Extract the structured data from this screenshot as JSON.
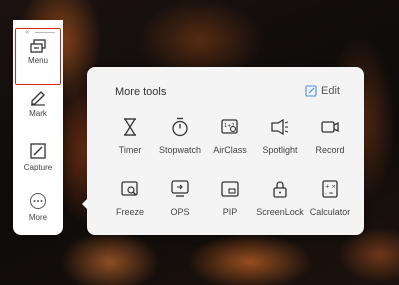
{
  "sidebar": {
    "collapse_glyph": "«",
    "menu_label": "Menu",
    "mark_label": "Mark",
    "capture_label": "Capture",
    "more_label": "More"
  },
  "panel": {
    "title": "More tools",
    "edit_label": "Edit",
    "row1": [
      {
        "label": "Timer",
        "icon": "hourglass-icon"
      },
      {
        "label": "Stopwatch",
        "icon": "stopwatch-icon"
      },
      {
        "label": "AirClass",
        "icon": "airclass-icon"
      },
      {
        "label": "Spotlight",
        "icon": "spotlight-icon"
      },
      {
        "label": "Record",
        "icon": "record-icon"
      }
    ],
    "row2": [
      {
        "label": "Freeze",
        "icon": "freeze-icon"
      },
      {
        "label": "OPS",
        "icon": "ops-icon"
      },
      {
        "label": "PIP",
        "icon": "pip-icon"
      },
      {
        "label": "ScreenLock",
        "icon": "lock-icon"
      },
      {
        "label": "Calculator",
        "icon": "calculator-icon"
      }
    ]
  },
  "colors": {
    "accent": "#4a90e2",
    "highlight": "#d9261c"
  }
}
